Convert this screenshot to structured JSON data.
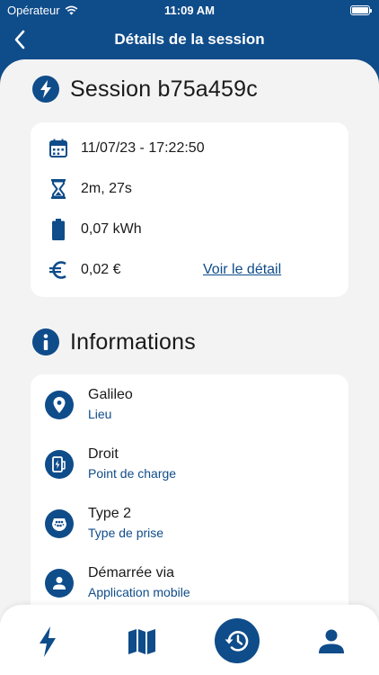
{
  "status_bar": {
    "carrier": "Opérateur",
    "time": "11:09 AM"
  },
  "header": {
    "title": "Détails de la session"
  },
  "session": {
    "title": "Session b75a459c",
    "date": "11/07/23 - 17:22:50",
    "duration": "2m, 27s",
    "energy": "0,07 kWh",
    "cost": "0,02 €",
    "details_link": "Voir le détail"
  },
  "informations": {
    "title": "Informations",
    "items": [
      {
        "value": "Galileo",
        "label": "Lieu",
        "icon": "location-pin-icon"
      },
      {
        "value": "Droit",
        "label": "Point de charge",
        "icon": "charging-point-icon"
      },
      {
        "value": "Type 2",
        "label": "Type de prise",
        "icon": "plug-type-icon"
      },
      {
        "value": "Démarrée via",
        "label": "Application mobile",
        "icon": "user-icon"
      }
    ]
  },
  "tabbar": {
    "tabs": [
      {
        "icon": "lightning-icon",
        "active": false
      },
      {
        "icon": "map-icon",
        "active": false
      },
      {
        "icon": "history-icon",
        "active": true
      },
      {
        "icon": "profile-icon",
        "active": false
      }
    ]
  },
  "colors": {
    "primary": "#0f4c8a",
    "background": "#f3f3f3",
    "card": "#ffffff"
  }
}
